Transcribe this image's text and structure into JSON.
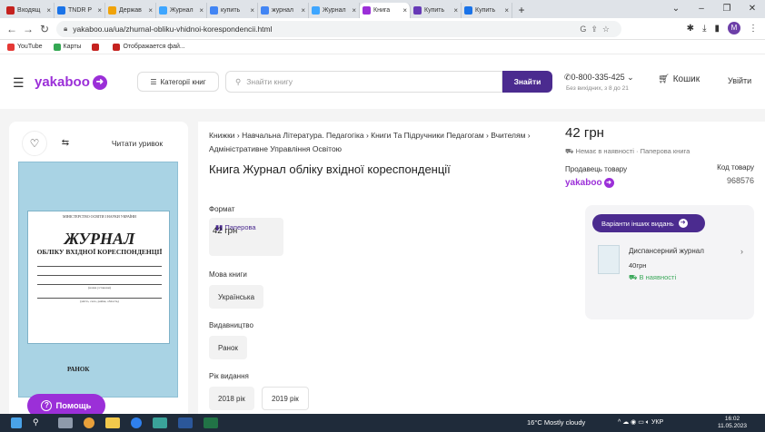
{
  "browser": {
    "tabs": [
      {
        "label": "Входящ",
        "color": "#c5221f"
      },
      {
        "label": "TNDR Р",
        "color": "#1a73e8"
      },
      {
        "label": "Держав",
        "color": "#f0a30a"
      },
      {
        "label": "Журнал",
        "color": "#3ea6ff"
      },
      {
        "label": "купить",
        "color": "#4285f4"
      },
      {
        "label": "журнал",
        "color": "#4285f4"
      },
      {
        "label": "Журнал",
        "color": "#3ea6ff"
      },
      {
        "label": "Книга",
        "color": "#9b2fd8"
      },
      {
        "label": "Купить",
        "color": "#673ab7"
      },
      {
        "label": "Купить",
        "color": "#1a73e8"
      }
    ],
    "active_tab_index": 7,
    "url": "yakaboo.ua/ua/zhurnal-obliku-vhidnoi-korespondencii.html",
    "bookmarks": [
      {
        "label": "YouTube",
        "color": "#e53935"
      },
      {
        "label": "Карты",
        "color": "#34a853"
      },
      {
        "label": "",
        "color": "#c5221f"
      },
      {
        "label": "Отображается фай...",
        "color": "#c5221f"
      }
    ],
    "profile_initial": "M"
  },
  "header": {
    "logo": "yakaboo",
    "categories_label": "Категорії книг",
    "search_placeholder": "Знайти книгу",
    "search_button": "Знайти",
    "phone": "0-800-335-425",
    "phone_sub": "Без вихідних, з 8 до 21",
    "cart_label": "Кошик",
    "login_label": "Увійти"
  },
  "product": {
    "read_excerpt": "Читати уривок",
    "breadcrumbs": "Книжки › Навчальна Література. Педагогіка › Книги Та Підручники Педагогам › Вчителям › Адміністративне Управління Освітою",
    "title": "Книга Журнал обліку вхідної кореспонденції",
    "format_label": "Формат",
    "format_name": "Паперова",
    "format_price": "42 грн",
    "language_label": "Мова книги",
    "language_value": "Українська",
    "publisher_label": "Видавництво",
    "publisher_value": "Ранок",
    "year_label": "Рік видання",
    "years": [
      "2018 рік",
      "2019 рік"
    ],
    "cover": {
      "ministry": "МІНІСТЕРСТВО ОСВІТИ І НАУКИ УКРАЇНИ",
      "title": "ЖУРНАЛ",
      "subtitle": "ОБЛІКУ ВХІДНОЇ КОРЕСПОНДЕНЦІЇ",
      "line_caption_1": "(назва установи)",
      "line_caption_2": "(місто, село, район, область)",
      "publisher": "РАНОК"
    }
  },
  "buybox": {
    "price": "42 грн",
    "availability": "Немає в наявності · Паперова книга",
    "seller_label": "Продавець товару",
    "seller_logo": "yakaboo",
    "code_label": "Код товару",
    "code_value": "968576",
    "editions_button": "Варіанти інших видань",
    "edition": {
      "title": "Диспансерний журнал",
      "price": "40грн",
      "availability": "В наявності"
    }
  },
  "help": {
    "label": "Помощь"
  },
  "taskbar": {
    "weather": "16°C Mostly cloudy",
    "lang": "УКР",
    "time": "16:02",
    "date": "11.05.2023"
  },
  "colors": {
    "brand": "#9b2fd8",
    "accent": "#4b2b8f",
    "in_stock": "#3ba85a"
  }
}
